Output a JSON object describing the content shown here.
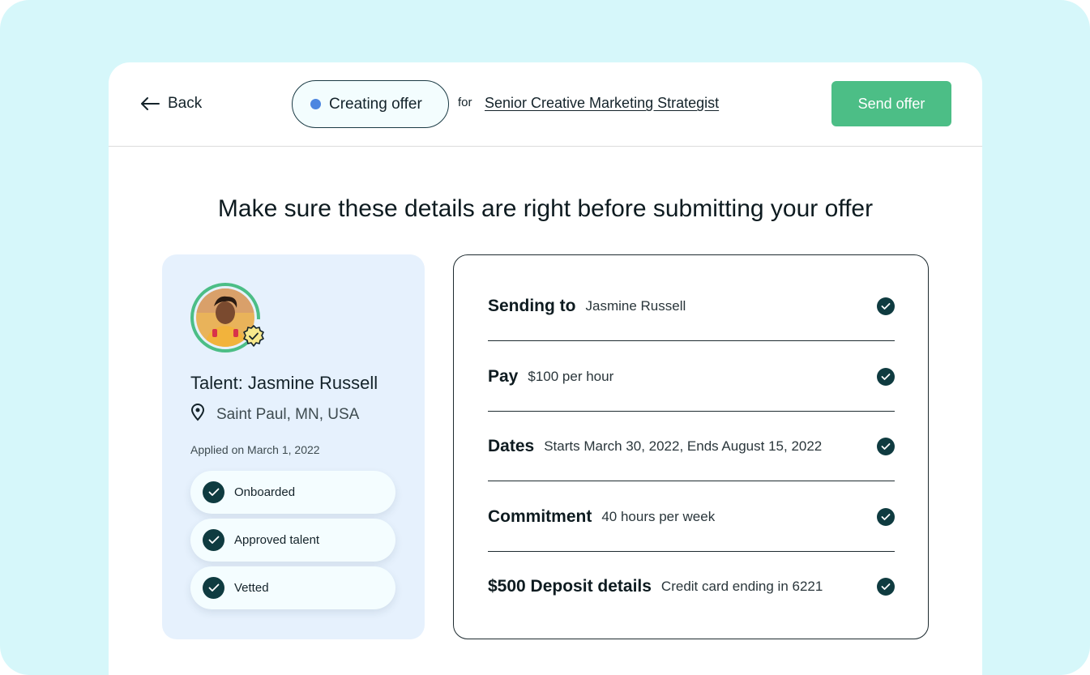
{
  "header": {
    "back_label": "Back",
    "status_label": "Creating offer",
    "for_label": "for",
    "job_title": "Senior Creative Marketing Strategist",
    "send_label": "Send offer"
  },
  "headline": "Make sure these details are right before submitting your offer",
  "talent": {
    "name": "Talent: Jasmine Russell",
    "location": "Saint Paul, MN, USA",
    "applied": "Applied on March 1, 2022",
    "chips": [
      "Onboarded",
      "Approved talent",
      "Vetted"
    ]
  },
  "details": [
    {
      "label": "Sending to",
      "value": "Jasmine Russell"
    },
    {
      "label": "Pay",
      "value": "$100 per hour"
    },
    {
      "label": "Dates",
      "value": "Starts March 30, 2022, Ends August 15, 2022"
    },
    {
      "label": "Commitment",
      "value": "40 hours per week"
    },
    {
      "label": "$500 Deposit details",
      "value": "Credit card ending in 6221"
    }
  ],
  "colors": {
    "background": "#d6f7fa",
    "accent": "#4cbe86",
    "status_dot": "#4d86e0",
    "check": "#0f3b40",
    "talent_card": "#e6f1fd"
  }
}
